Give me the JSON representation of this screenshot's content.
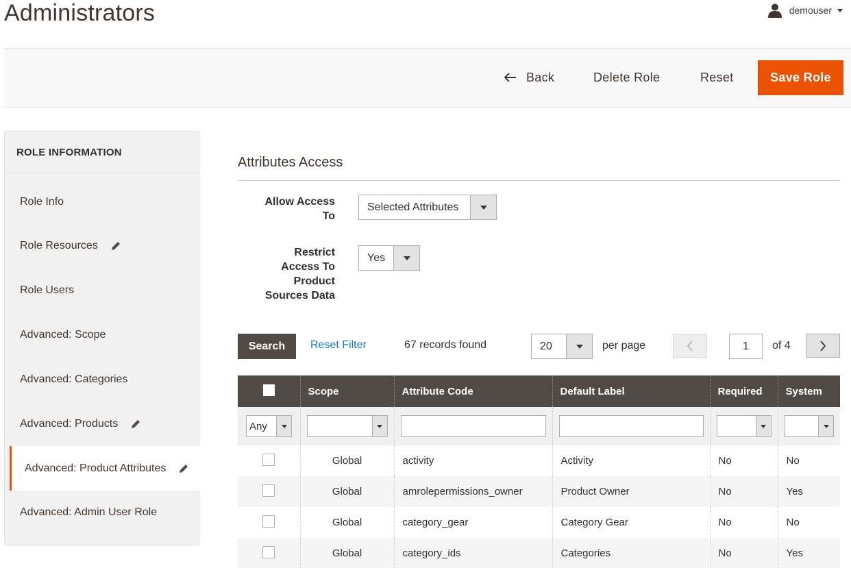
{
  "header": {
    "page_title": "Administrators",
    "username": "demouser"
  },
  "toolbar": {
    "back_label": "Back",
    "delete_label": "Delete Role",
    "reset_label": "Reset",
    "save_label": "Save Role"
  },
  "sidebar": {
    "heading": "ROLE INFORMATION",
    "items": [
      {
        "label": "Role Info",
        "edit": false
      },
      {
        "label": "Role Resources",
        "edit": true
      },
      {
        "label": "Role Users",
        "edit": false
      },
      {
        "label": "Advanced: Scope",
        "edit": false
      },
      {
        "label": "Advanced: Categories",
        "edit": false
      },
      {
        "label": "Advanced: Products",
        "edit": true
      },
      {
        "label": "Advanced: Product Attributes",
        "edit": true,
        "active": true
      },
      {
        "label": "Advanced: Admin User Role",
        "edit": false
      }
    ]
  },
  "section": {
    "title": "Attributes Access",
    "allow_access_label_1": "Allow Access",
    "allow_access_label_2": "To",
    "allow_access_value": "Selected Attributes",
    "restrict_label_1": "Restrict",
    "restrict_label_2": "Access To",
    "restrict_label_3": "Product",
    "restrict_label_4": "Sources Data",
    "restrict_value": "Yes"
  },
  "grid_controls": {
    "search_label": "Search",
    "reset_filter_label": "Reset Filter",
    "records_found": "67 records found",
    "per_page_value": "20",
    "per_page_label": "per page",
    "current_page": "1",
    "of_pages": "of 4"
  },
  "grid": {
    "columns": [
      "",
      "Scope",
      "Attribute Code",
      "Default Label",
      "Required",
      "System"
    ],
    "filters": {
      "first_select": "Any"
    },
    "rows": [
      {
        "scope": "Global",
        "code": "activity",
        "label": "Activity",
        "required": "No",
        "system": "No"
      },
      {
        "scope": "Global",
        "code": "amrolepermissions_owner",
        "label": "Product Owner",
        "required": "No",
        "system": "Yes"
      },
      {
        "scope": "Global",
        "code": "category_gear",
        "label": "Category Gear",
        "required": "No",
        "system": "No"
      },
      {
        "scope": "Global",
        "code": "category_ids",
        "label": "Categories",
        "required": "No",
        "system": "Yes"
      }
    ]
  },
  "colors": {
    "accent": "#eb5202",
    "grid_header": "#514943",
    "link": "#1979c3"
  }
}
